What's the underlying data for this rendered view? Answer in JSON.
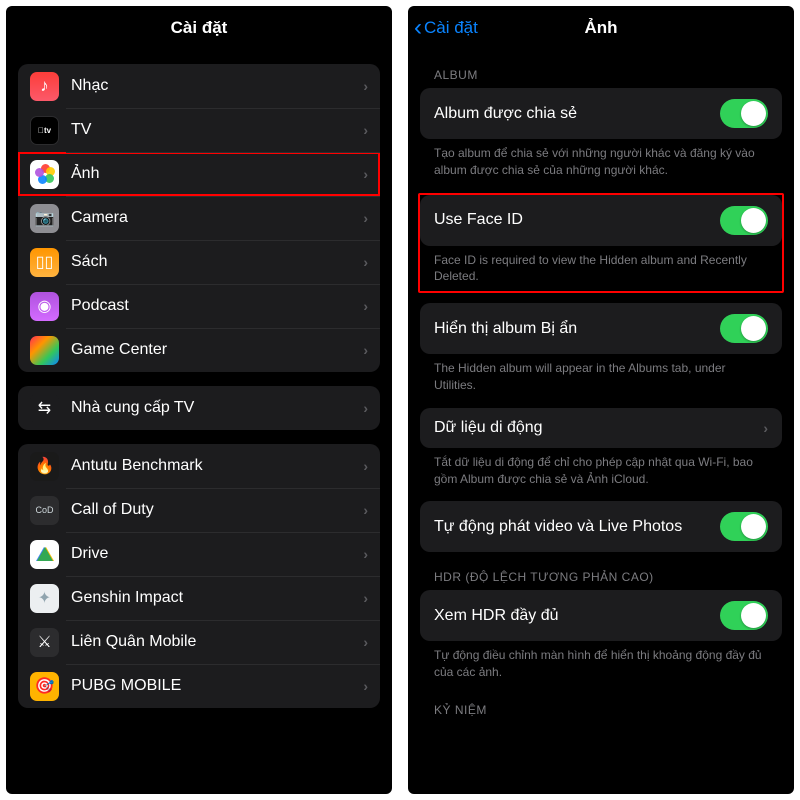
{
  "left": {
    "title": "Cài đặt",
    "group1": [
      {
        "name": "nhac",
        "label": "Nhạc",
        "icon": "music"
      },
      {
        "name": "tv",
        "label": "TV",
        "icon": "tv"
      },
      {
        "name": "anh",
        "label": "Ảnh",
        "icon": "photos",
        "highlighted": true
      },
      {
        "name": "camera",
        "label": "Camera",
        "icon": "camera"
      },
      {
        "name": "sach",
        "label": "Sách",
        "icon": "books"
      },
      {
        "name": "podcast",
        "label": "Podcast",
        "icon": "podcast"
      },
      {
        "name": "game-center",
        "label": "Game Center",
        "icon": "gc"
      }
    ],
    "group2": [
      {
        "name": "tv-provider",
        "label": "Nhà cung cấp TV",
        "icon": "tvp"
      }
    ],
    "group3": [
      {
        "name": "antutu",
        "label": "Antutu Benchmark",
        "icon": "antutu"
      },
      {
        "name": "cod",
        "label": "Call of Duty",
        "icon": "cod"
      },
      {
        "name": "drive",
        "label": "Drive",
        "icon": "drive"
      },
      {
        "name": "genshin",
        "label": "Genshin Impact",
        "icon": "gi"
      },
      {
        "name": "lienquan",
        "label": "Liên Quân Mobile",
        "icon": "lq"
      },
      {
        "name": "pubg",
        "label": "PUBG MOBILE",
        "icon": "pubg"
      }
    ]
  },
  "right": {
    "back": "Cài đặt",
    "title": "Ảnh",
    "sections": {
      "album_header": "ALBUM",
      "shared_album_label": "Album được chia sẻ",
      "shared_album_footer": "Tạo album để chia sẻ với những người khác và đăng ký vào album được chia sẻ của những người khác.",
      "faceid_label": "Use Face ID",
      "faceid_footer": "Face ID is required to view the Hidden album and Recently Deleted.",
      "hidden_label": "Hiển thị album Bị ẩn",
      "hidden_footer": "The Hidden album will appear in the Albums tab, under Utilities.",
      "cellular_label": "Dữ liệu di động",
      "cellular_footer": "Tắt dữ liệu di động để chỉ cho phép cập nhật qua Wi-Fi, bao gồm Album được chia sẻ và Ảnh iCloud.",
      "autoplay_label": "Tự động phát video và Live Photos",
      "hdr_header": "HDR (ĐỘ LỆCH TƯƠNG PHẢN CAO)",
      "hdr_label": "Xem HDR đầy đủ",
      "hdr_footer": "Tự động điều chỉnh màn hình để hiển thị khoảng động đầy đủ của các ảnh.",
      "memories_header": "KỶ NIỆM"
    }
  }
}
